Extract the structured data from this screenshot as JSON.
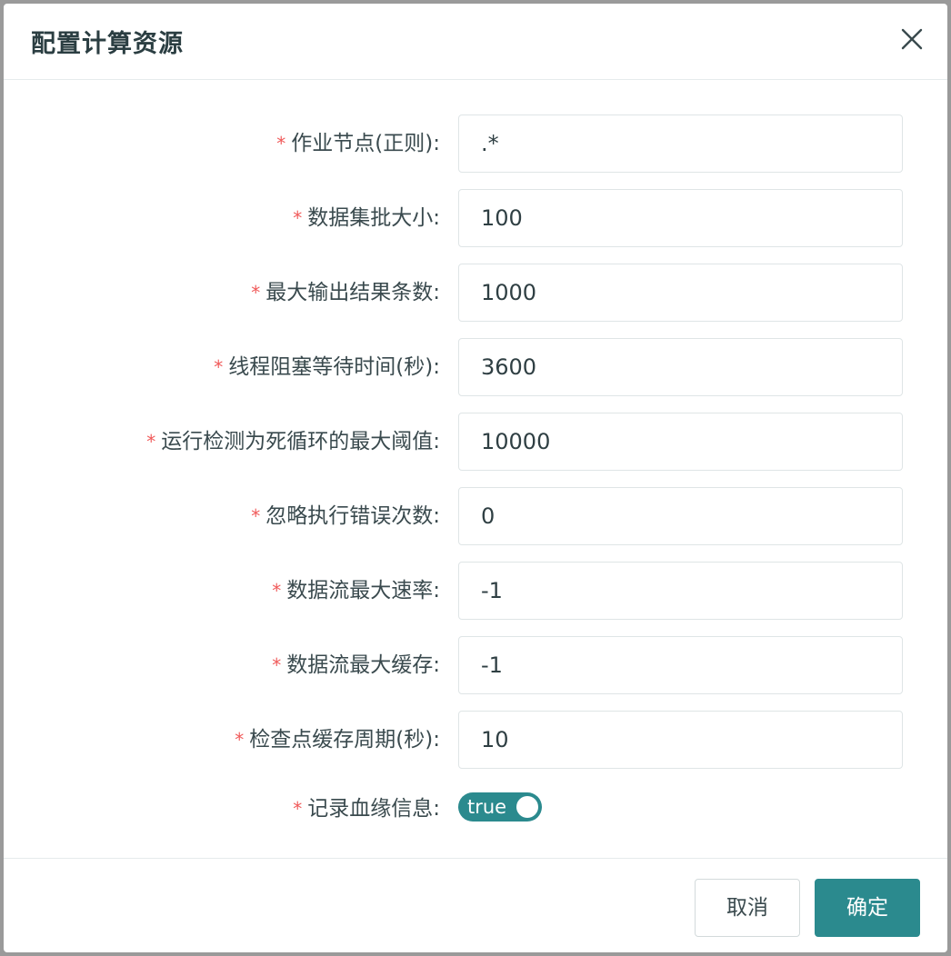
{
  "dialog": {
    "title": "配置计算资源",
    "close_icon": "close-icon"
  },
  "form": {
    "required_mark": "*",
    "fields": [
      {
        "label": "作业节点(正则):",
        "value": ".*"
      },
      {
        "label": "数据集批大小:",
        "value": "100"
      },
      {
        "label": "最大输出结果条数:",
        "value": "1000"
      },
      {
        "label": "线程阻塞等待时间(秒):",
        "value": "3600"
      },
      {
        "label": "运行检测为死循环的最大阈值:",
        "value": "10000"
      },
      {
        "label": "忽略执行错误次数:",
        "value": "0"
      },
      {
        "label": "数据流最大速率:",
        "value": "-1"
      },
      {
        "label": "数据流最大缓存:",
        "value": "-1"
      },
      {
        "label": "检查点缓存周期(秒):",
        "value": "10"
      }
    ],
    "switch_field": {
      "label": "记录血缘信息:",
      "value": "true",
      "checked": true
    }
  },
  "footer": {
    "cancel_label": "取消",
    "ok_label": "确定"
  },
  "colors": {
    "accent": "#2b8a8e",
    "required": "#f05a5a"
  }
}
